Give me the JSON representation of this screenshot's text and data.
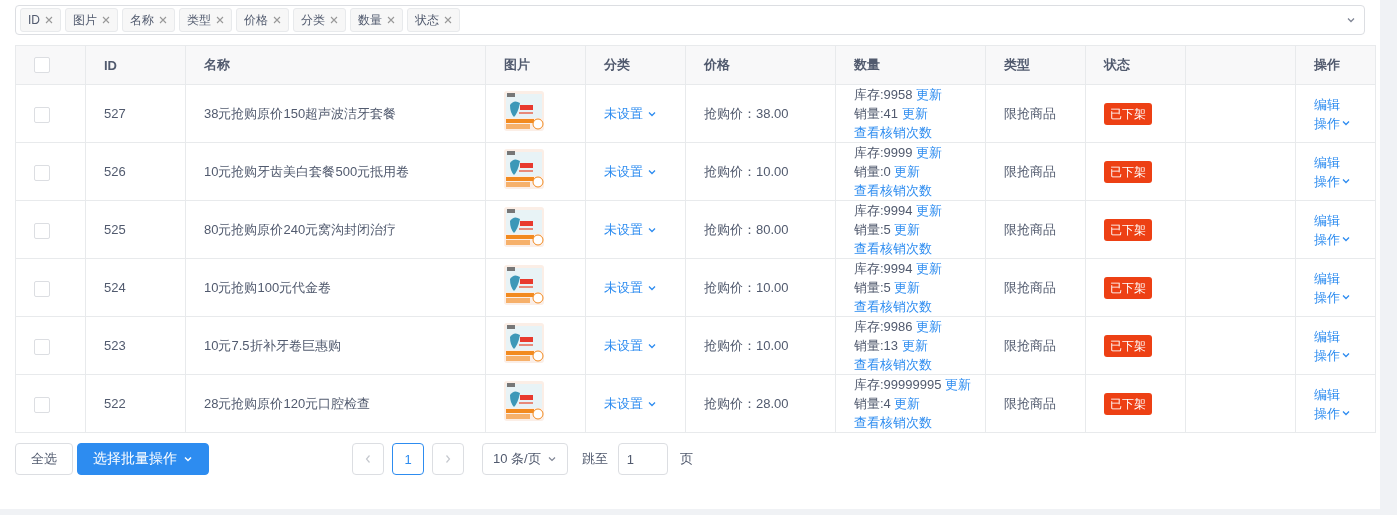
{
  "filter_tags": [
    {
      "label": "ID"
    },
    {
      "label": "图片"
    },
    {
      "label": "名称"
    },
    {
      "label": "类型"
    },
    {
      "label": "价格"
    },
    {
      "label": "分类"
    },
    {
      "label": "数量"
    },
    {
      "label": "状态"
    }
  ],
  "table": {
    "all_checked": false,
    "columns": [
      "ID",
      "名称",
      "图片",
      "分类",
      "价格",
      "数量",
      "类型",
      "状态",
      "操作"
    ],
    "rows": [
      {
        "checked": false,
        "id": "527",
        "name": "38元抢购原价150超声波洁牙套餐",
        "category": "未设置",
        "price": "抢购价：38.00",
        "stock": "库存:9958",
        "stock_action": "更新",
        "sales": "销量:41",
        "sales_action": "更新",
        "verify_link": "查看核销次数",
        "type": "限抢商品",
        "status": "已下架",
        "edit": "编辑",
        "more": "操作"
      },
      {
        "checked": false,
        "id": "526",
        "name": "10元抢购牙齿美白套餐500元抵用卷",
        "category": "未设置",
        "price": "抢购价：10.00",
        "stock": "库存:9999",
        "stock_action": "更新",
        "sales": "销量:0",
        "sales_action": "更新",
        "verify_link": "查看核销次数",
        "type": "限抢商品",
        "status": "已下架",
        "edit": "编辑",
        "more": "操作"
      },
      {
        "checked": false,
        "id": "525",
        "name": "80元抢购原价240元窝沟封闭治疗",
        "category": "未设置",
        "price": "抢购价：80.00",
        "stock": "库存:9994",
        "stock_action": "更新",
        "sales": "销量:5",
        "sales_action": "更新",
        "verify_link": "查看核销次数",
        "type": "限抢商品",
        "status": "已下架",
        "edit": "编辑",
        "more": "操作"
      },
      {
        "checked": false,
        "id": "524",
        "name": "10元抢购100元代金卷",
        "category": "未设置",
        "price": "抢购价：10.00",
        "stock": "库存:9994",
        "stock_action": "更新",
        "sales": "销量:5",
        "sales_action": "更新",
        "verify_link": "查看核销次数",
        "type": "限抢商品",
        "status": "已下架",
        "edit": "编辑",
        "more": "操作"
      },
      {
        "checked": false,
        "id": "523",
        "name": "10元7.5折补牙卷巨惠购",
        "category": "未设置",
        "price": "抢购价：10.00",
        "stock": "库存:9986",
        "stock_action": "更新",
        "sales": "销量:13",
        "sales_action": "更新",
        "verify_link": "查看核销次数",
        "type": "限抢商品",
        "status": "已下架",
        "edit": "编辑",
        "more": "操作"
      },
      {
        "checked": false,
        "id": "522",
        "name": "28元抢购原价120元口腔检查",
        "category": "未设置",
        "price": "抢购价：28.00",
        "stock": "库存:99999995",
        "stock_action": "更新",
        "sales": "销量:4",
        "sales_action": "更新",
        "verify_link": "查看核销次数",
        "type": "限抢商品",
        "status": "已下架",
        "edit": "编辑",
        "more": "操作"
      }
    ]
  },
  "footer": {
    "select_all": "全选",
    "batch_button": "选择批量操作",
    "pages": [
      {
        "label": "1",
        "selected": true
      }
    ],
    "page_size": "10 条/页",
    "jump_label": "跳至",
    "jump_value": "1",
    "page_unit": "页"
  }
}
